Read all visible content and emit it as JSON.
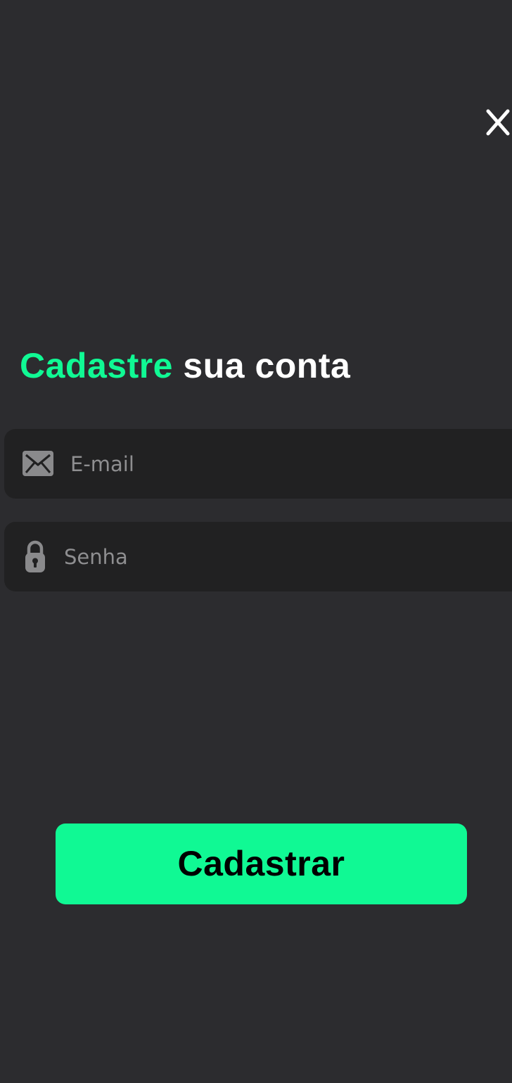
{
  "header": {
    "close_icon": "close-icon"
  },
  "title": {
    "accent": "Cadastre",
    "rest": "sua conta"
  },
  "form": {
    "email": {
      "icon": "envelope-icon",
      "placeholder": "E-mail",
      "value": ""
    },
    "password": {
      "icon": "lock-icon",
      "placeholder": "Senha",
      "value": ""
    },
    "submit_label": "Cadastrar"
  },
  "colors": {
    "background": "#2c2c2f",
    "field_background": "#212122",
    "accent": "#10f994",
    "title_text": "#ffffff",
    "placeholder": "#8e8e90",
    "button_text": "#000000"
  }
}
